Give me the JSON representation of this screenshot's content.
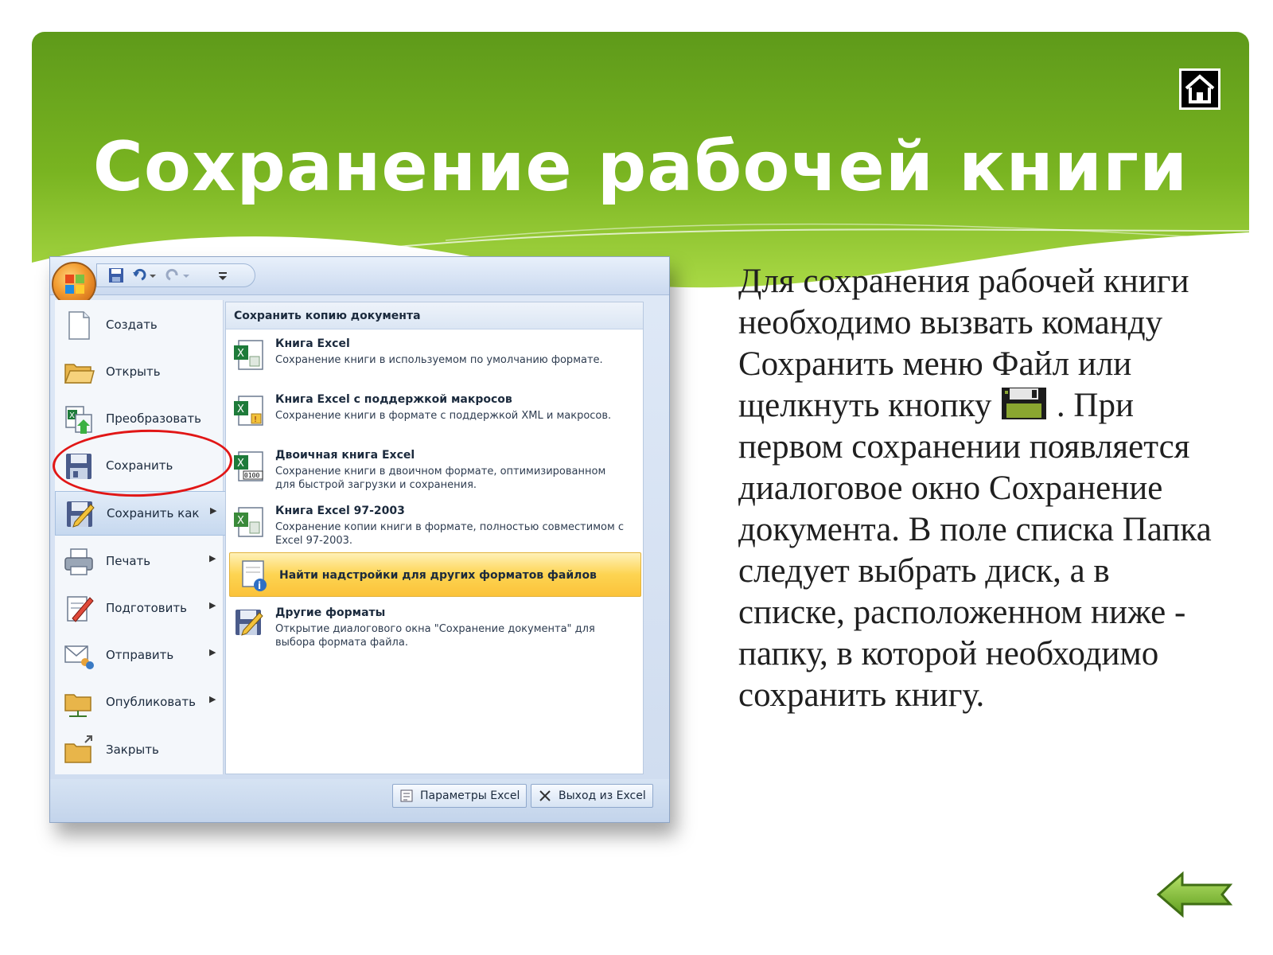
{
  "slide": {
    "title": "Сохранение рабочей книги"
  },
  "nav": {
    "home_icon": "home-icon",
    "back_icon": "back-arrow-icon"
  },
  "colors": {
    "header_green_dark": "#5e9a1a",
    "header_green_light": "#b9e25a",
    "highlight_red": "#e11616",
    "menu_highlight": "#fbc23a"
  },
  "excel_menu": {
    "left_items": [
      {
        "label": "Создать",
        "icon": "new-document-icon",
        "has_arrow": false
      },
      {
        "label": "Открыть",
        "icon": "open-folder-icon",
        "has_arrow": false
      },
      {
        "label": "Преобразовать",
        "icon": "convert-icon",
        "has_arrow": false
      },
      {
        "label": "Сохранить",
        "icon": "save-floppy-icon",
        "has_arrow": false
      },
      {
        "label": "Сохранить как",
        "icon": "save-as-icon",
        "has_arrow": true
      },
      {
        "label": "Печать",
        "icon": "printer-icon",
        "has_arrow": true
      },
      {
        "label": "Подготовить",
        "icon": "prepare-icon",
        "has_arrow": true
      },
      {
        "label": "Отправить",
        "icon": "send-icon",
        "has_arrow": true
      },
      {
        "label": "Опубликовать",
        "icon": "publish-icon",
        "has_arrow": true
      },
      {
        "label": "Закрыть",
        "icon": "close-folder-icon",
        "has_arrow": false
      }
    ],
    "arrow_glyph": "▶",
    "submenu": {
      "header": "Сохранить копию документа",
      "items": [
        {
          "title": "Книга Excel",
          "description": "Сохранение книги в используемом по умолчанию формате."
        },
        {
          "title": "Книга Excel с поддержкой макросов",
          "description": "Сохранение книги в формате с поддержкой XML и макросов."
        },
        {
          "title": "Двоичная книга Excel",
          "description": "Сохранение книги в двоичном формате, оптимизированном для быстрой загрузки и сохранения."
        },
        {
          "title": "Книга Excel 97-2003",
          "description": "Сохранение копии книги в формате, полностью совместимом с Excel 97-2003."
        },
        {
          "title": "Найти надстройки для других форматов файлов",
          "description": ""
        },
        {
          "title": "Другие форматы",
          "description": "Открытие диалогового окна \"Сохранение документа\" для выбора формата файла."
        }
      ]
    },
    "footer": {
      "options_label": "Параметры Excel",
      "exit_label": "Выход из Excel"
    }
  },
  "body": {
    "part1": "Для сохранения рабочей книги необходимо вызвать команду Сохранить меню Файл или щелкнуть кнопку",
    "part2": ". При первом сохранении появляется диалоговое окно Сохранение документа. В поле списка Папка следует выбрать диск, а в списке, расположенном ниже - папку, в которой необходимо сохранить книгу."
  }
}
